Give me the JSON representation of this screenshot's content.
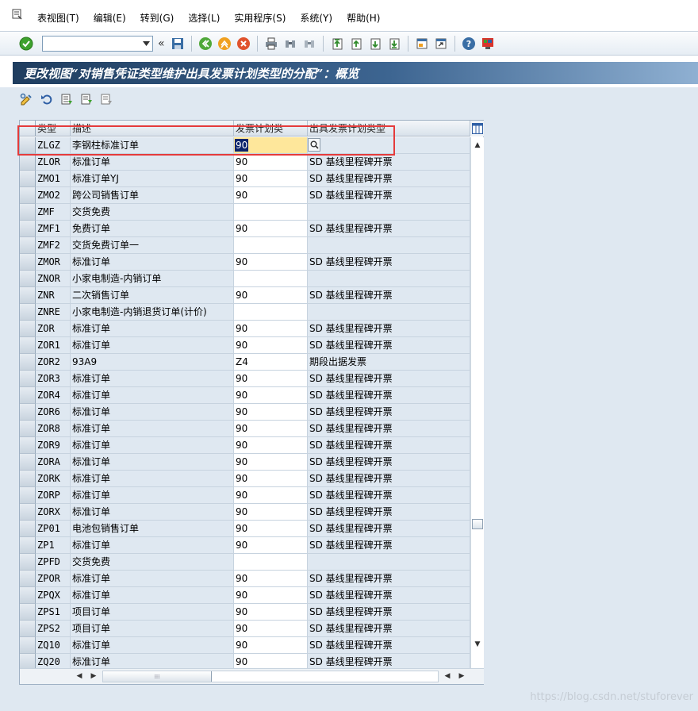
{
  "menubar": {
    "items": [
      "表视图(T)",
      "编辑(E)",
      "转到(G)",
      "选择(L)",
      "实用程序(S)",
      "系统(Y)",
      "帮助(H)"
    ]
  },
  "toolbar": {
    "command_value": "",
    "collapse_glyph": "«"
  },
  "title": "更改视图“对销售凭证类型维护出具发票计划类型的分配”：概览",
  "table": {
    "columns": [
      "类型",
      "描述",
      "发票计划类",
      "出具发票计划类型"
    ],
    "rows": [
      {
        "type": "ZLGZ",
        "desc": "李钢柱标准订单",
        "inv": "90",
        "sched": ""
      },
      {
        "type": "ZLOR",
        "desc": "标准订单",
        "inv": "90",
        "sched": "SD 基线里程碑开票"
      },
      {
        "type": "ZMO1",
        "desc": "标准订单YJ",
        "inv": "90",
        "sched": "SD 基线里程碑开票"
      },
      {
        "type": "ZMO2",
        "desc": "跨公司销售订单",
        "inv": "90",
        "sched": "SD 基线里程碑开票"
      },
      {
        "type": "ZMF",
        "desc": "交货免费",
        "inv": "",
        "sched": ""
      },
      {
        "type": "ZMF1",
        "desc": "免费订单",
        "inv": "90",
        "sched": "SD 基线里程碑开票"
      },
      {
        "type": "ZMF2",
        "desc": "交货免费订单一",
        "inv": "",
        "sched": ""
      },
      {
        "type": "ZMOR",
        "desc": "标准订单",
        "inv": "90",
        "sched": "SD 基线里程碑开票"
      },
      {
        "type": "ZNOR",
        "desc": "小家电制造-内销订单",
        "inv": "",
        "sched": ""
      },
      {
        "type": "ZNR",
        "desc": "二次销售订单",
        "inv": "90",
        "sched": "SD 基线里程碑开票"
      },
      {
        "type": "ZNRE",
        "desc": "小家电制造-内销退货订单(计价)",
        "inv": "",
        "sched": ""
      },
      {
        "type": "ZOR",
        "desc": "标准订单",
        "inv": "90",
        "sched": "SD 基线里程碑开票"
      },
      {
        "type": "ZOR1",
        "desc": "标准订单",
        "inv": "90",
        "sched": "SD 基线里程碑开票"
      },
      {
        "type": "ZOR2",
        "desc": "93A9",
        "inv": "Z4",
        "sched": "期段出据发票"
      },
      {
        "type": "ZOR3",
        "desc": "标准订单",
        "inv": "90",
        "sched": "SD 基线里程碑开票"
      },
      {
        "type": "ZOR4",
        "desc": "标准订单",
        "inv": "90",
        "sched": "SD 基线里程碑开票"
      },
      {
        "type": "ZOR6",
        "desc": "标准订单",
        "inv": "90",
        "sched": "SD 基线里程碑开票"
      },
      {
        "type": "ZOR8",
        "desc": "标准订单",
        "inv": "90",
        "sched": "SD 基线里程碑开票"
      },
      {
        "type": "ZOR9",
        "desc": "标准订单",
        "inv": "90",
        "sched": "SD 基线里程碑开票"
      },
      {
        "type": "ZORA",
        "desc": "标准订单",
        "inv": "90",
        "sched": "SD 基线里程碑开票"
      },
      {
        "type": "ZORK",
        "desc": "标准订单",
        "inv": "90",
        "sched": "SD 基线里程碑开票"
      },
      {
        "type": "ZORP",
        "desc": "标准订单",
        "inv": "90",
        "sched": "SD 基线里程碑开票"
      },
      {
        "type": "ZORX",
        "desc": "标准订单",
        "inv": "90",
        "sched": "SD 基线里程碑开票"
      },
      {
        "type": "ZP01",
        "desc": "电池包销售订单",
        "inv": "90",
        "sched": "SD 基线里程碑开票"
      },
      {
        "type": "ZP1",
        "desc": "标准订单",
        "inv": "90",
        "sched": "SD 基线里程碑开票"
      },
      {
        "type": "ZPFD",
        "desc": "交货免费",
        "inv": "",
        "sched": ""
      },
      {
        "type": "ZPOR",
        "desc": "标准订单",
        "inv": "90",
        "sched": "SD 基线里程碑开票"
      },
      {
        "type": "ZPQX",
        "desc": "标准订单",
        "inv": "90",
        "sched": "SD 基线里程碑开票"
      },
      {
        "type": "ZPS1",
        "desc": "项目订单",
        "inv": "90",
        "sched": "SD 基线里程碑开票"
      },
      {
        "type": "ZPS2",
        "desc": "项目订单",
        "inv": "90",
        "sched": "SD 基线里程碑开票"
      },
      {
        "type": "ZQ10",
        "desc": "标准订单",
        "inv": "90",
        "sched": "SD 基线里程碑开票"
      },
      {
        "type": "ZQ20",
        "desc": "标准订单",
        "inv": "90",
        "sched": "SD 基线里程碑开票"
      }
    ]
  },
  "watermark": "https://blog.csdn.net/stuforever",
  "colors": {
    "title_band_dark": "#1f3d5f",
    "active_cell": "#fee79b",
    "highlight_border": "#e53b3b",
    "readonly_cell": "#dfe8f1"
  }
}
